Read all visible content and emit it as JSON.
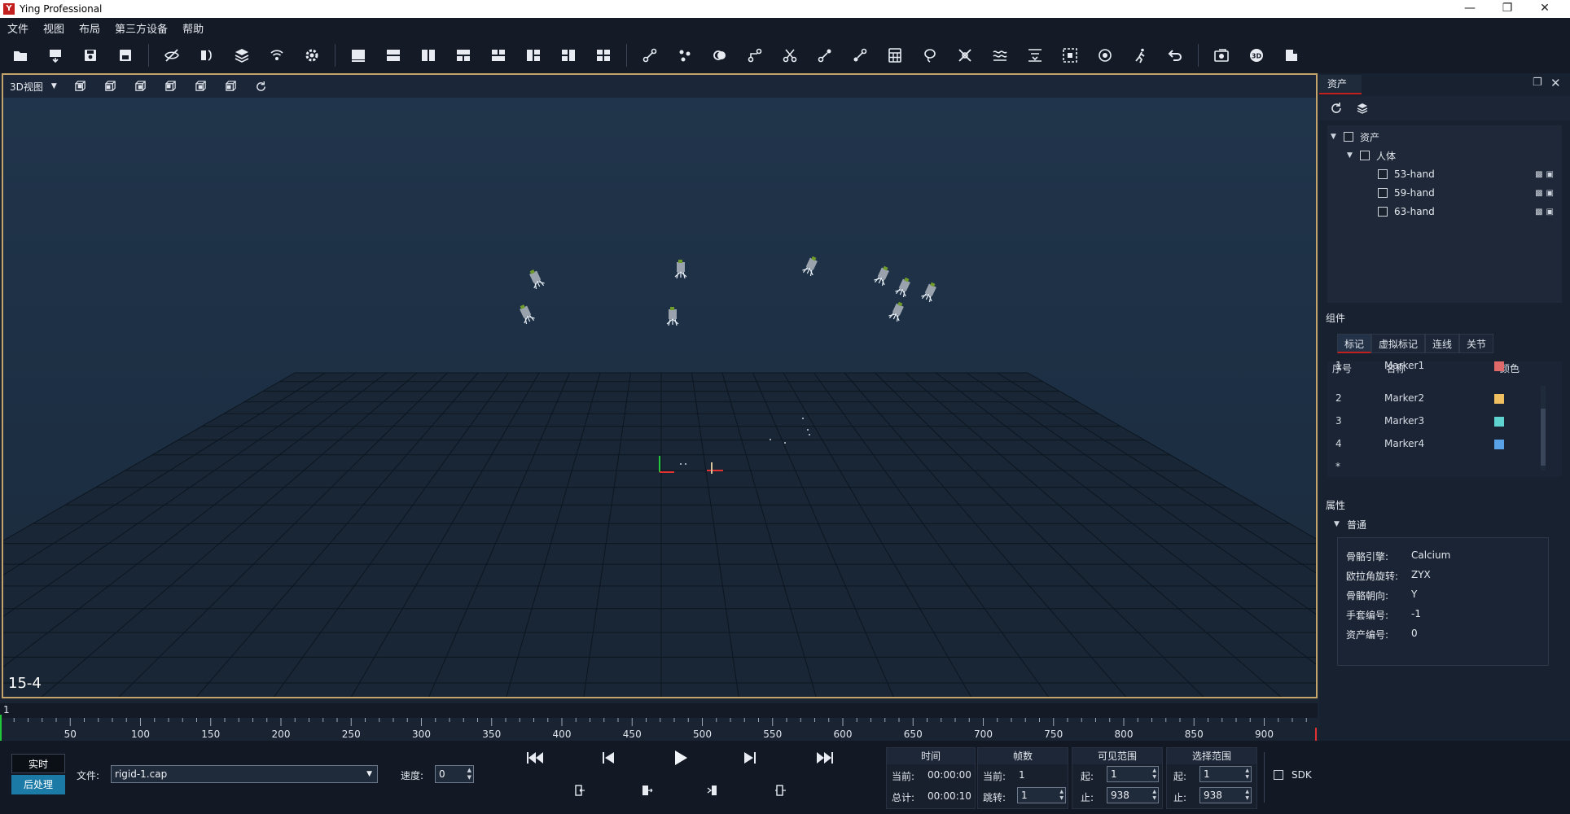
{
  "app": {
    "title": "Ying Professional",
    "logo_text": "Y"
  },
  "menu": [
    "文件",
    "视图",
    "布局",
    "第三方设备",
    "帮助"
  ],
  "toolbar_icons": [
    "open-folder-icon",
    "capture-icon",
    "save-icon",
    "save-as-icon",
    "hide-icon",
    "mirror-icon",
    "layers-icon",
    "network-icon",
    "settings-icon",
    "layout-single-icon",
    "layout-split-h-icon",
    "layout-split-v-icon",
    "layout-grid-icon",
    "layout-top-icon",
    "layout-columns-icon",
    "layout-mixed-icon",
    "layout-quad-icon",
    "bone-link-icon",
    "multi-link-icon",
    "ring-icon",
    "nodes-icon",
    "scissors-icon",
    "connect-icon",
    "edge-icon",
    "calculator-icon",
    "lasso-icon",
    "cross-icon",
    "wave-icon",
    "filter-icon",
    "select-box-icon",
    "target-icon",
    "run-icon",
    "undo-icon",
    "camera-record-icon",
    "3d-icon",
    "export-icon"
  ],
  "view": {
    "mode": "3D视图",
    "tool_icons": [
      "cube-front-icon",
      "cube-top-icon",
      "cube-side-icon",
      "cube-back-icon",
      "cube-left-icon",
      "cube-right-icon",
      "reset-view-icon"
    ],
    "label": "15-4",
    "axis_x": "X",
    "axis_y": "Y"
  },
  "assets": {
    "tab": "资产",
    "root": "资产",
    "group": "人体",
    "items": [
      "53-hand",
      "59-hand",
      "63-hand"
    ]
  },
  "components": {
    "title": "组件",
    "tabs": [
      "标记",
      "虚拟标记",
      "连线",
      "关节"
    ],
    "headers": {
      "index": "序号",
      "name": "名称",
      "color": "颜色"
    },
    "rows": [
      {
        "index": "1",
        "name": "Marker1",
        "color": "#e06a6a"
      },
      {
        "index": "2",
        "name": "Marker2",
        "color": "#f0c060"
      },
      {
        "index": "3",
        "name": "Marker3",
        "color": "#5fd3d0"
      },
      {
        "index": "4",
        "name": "Marker4",
        "color": "#5aa2e8"
      }
    ],
    "new_row": "*"
  },
  "properties": {
    "title": "属性",
    "section": "普通",
    "rows": [
      {
        "label": "骨骼引擎:",
        "value": "Calcium"
      },
      {
        "label": "欧拉角旋转:",
        "value": "ZYX"
      },
      {
        "label": "骨骼朝向:",
        "value": "Y"
      },
      {
        "label": "手套编号:",
        "value": "-1"
      },
      {
        "label": "资产编号:",
        "value": "0"
      }
    ]
  },
  "timeline": {
    "current_frame": "1",
    "ticks": [
      "50",
      "100",
      "150",
      "200",
      "250",
      "300",
      "350",
      "400",
      "450",
      "500",
      "550",
      "600",
      "650",
      "700",
      "750",
      "800",
      "850",
      "900"
    ]
  },
  "bottom": {
    "realtime_label": "实时",
    "postprocess_label": "后处理",
    "file_label": "文件:",
    "file_value": "rigid-1.cap",
    "speed_label": "速度:",
    "speed_value": "0",
    "time_head": "时间",
    "time_current_label": "当前:",
    "time_current": "00:00:00",
    "time_total_label": "总计:",
    "time_total": "00:00:10",
    "frames_head": "帧数",
    "frames_current_label": "当前:",
    "frames_current": "1",
    "frames_jump_label": "跳转:",
    "frames_jump": "1",
    "visible_head": "可见范围",
    "visible_start_label": "起:",
    "visible_start": "1",
    "visible_end_label": "止:",
    "visible_end": "938",
    "select_head": "选择范围",
    "select_start_label": "起:",
    "select_start": "1",
    "select_end_label": "止:",
    "select_end": "938",
    "sdk_label": "SDK"
  },
  "colors": {
    "accent": "#c2201f",
    "realtime_bg": "#0b0f16",
    "postprocess_bg": "#1b7aa6",
    "view_border": "#c4a46a"
  }
}
